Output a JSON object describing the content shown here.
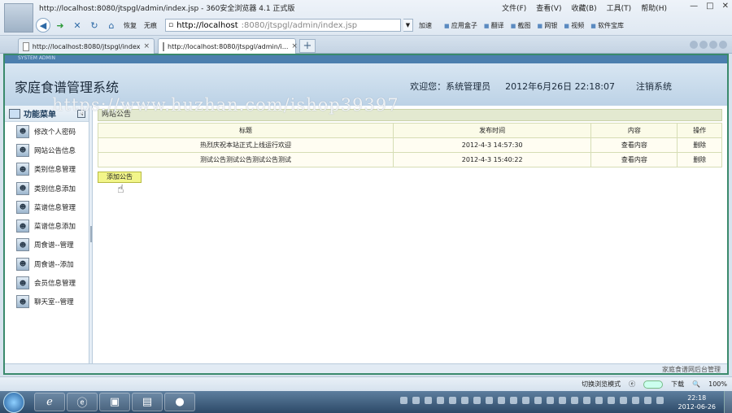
{
  "window": {
    "title": "http://localhost:8080/jtspgl/admin/index.jsp - 360安全浏览器 4.1 正式版",
    "menu": [
      "文件(F)",
      "查看(V)",
      "收藏(B)",
      "工具(T)",
      "帮助(H)"
    ]
  },
  "toolbar": {
    "restore_label": "恢复",
    "traceless_label": "无痕",
    "address_host": "http://localhost",
    "address_path": ":8080/jtspgl/admin/index.jsp",
    "accelerate_label": "加速",
    "right_tools": [
      "应用盒子",
      "翻译",
      "截图",
      "网银",
      "视频",
      "软件宝库"
    ]
  },
  "tabs": [
    {
      "label": "http://localhost:8080/jtspgl/index"
    },
    {
      "label": "http://localhost:8080/jtspgl/admin/i..."
    }
  ],
  "app": {
    "top_strip": "SYSTEM ADMIN",
    "title": "家庭食谱管理系统",
    "welcome": "欢迎您：系统管理员",
    "datetime": "2012年6月26日  22:18:07",
    "logout": "注销系统"
  },
  "watermark": "https://www.huzhan.com/ishop39397",
  "sidebar": {
    "title": "功能菜单",
    "items": [
      {
        "label": "修改个人密码"
      },
      {
        "label": "网站公告信息"
      },
      {
        "label": "类别信息管理"
      },
      {
        "label": "类别信息添加"
      },
      {
        "label": "菜谱信息管理"
      },
      {
        "label": "菜谱信息添加"
      },
      {
        "label": "周食谱--管理"
      },
      {
        "label": "周食谱--添加"
      },
      {
        "label": "会员信息管理"
      },
      {
        "label": "聊天室--管理"
      }
    ]
  },
  "main": {
    "breadcrumb": "网站公告",
    "columns": [
      "标题",
      "发布时间",
      "内容",
      "操作"
    ],
    "rows": [
      {
        "title": "热烈庆祝本站正式上线运行欢迎",
        "time": "2012-4-3 14:57:30",
        "content": "查看内容",
        "action": "删除"
      },
      {
        "title": "测试公告测试公告测试公告测试",
        "time": "2012-4-3 15:40:22",
        "content": "查看内容",
        "action": "删除"
      }
    ],
    "add_button": "添加公告",
    "footer": "家庭食谱网后台管理"
  },
  "statusbar": {
    "mode_label": "切换浏览模式",
    "download_label": "下载",
    "zoom": "100%"
  },
  "taskbar": {
    "time": "22:18",
    "date": "2012-06-26"
  }
}
